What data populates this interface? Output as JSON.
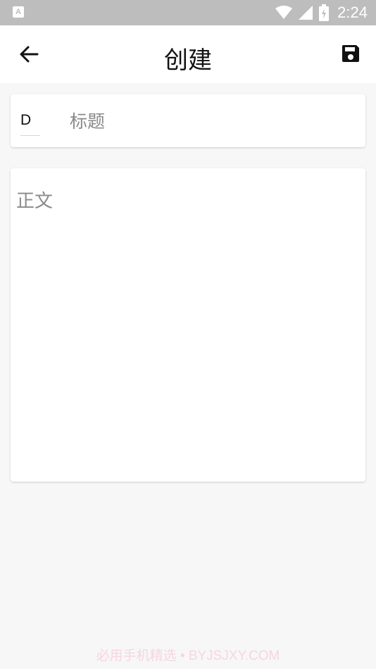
{
  "status_bar": {
    "time": "2:24",
    "left_icon_letter": "A",
    "icons": [
      "wifi-icon",
      "signal-icon",
      "battery-charging-icon"
    ]
  },
  "app_bar": {
    "title": "创建",
    "back_icon": "arrow-back-icon",
    "save_icon": "floppy-save-icon"
  },
  "title_card": {
    "prefix": "D",
    "title_placeholder": "标题",
    "title_value": ""
  },
  "body_card": {
    "body_placeholder": "正文",
    "body_value": ""
  },
  "watermark": "必用手机精选 • BYJSJXY.COM",
  "colors": {
    "status_bar": "#bdbdbd",
    "background": "#f7f7f7",
    "card": "#ffffff",
    "placeholder": "#8a8a8a"
  }
}
